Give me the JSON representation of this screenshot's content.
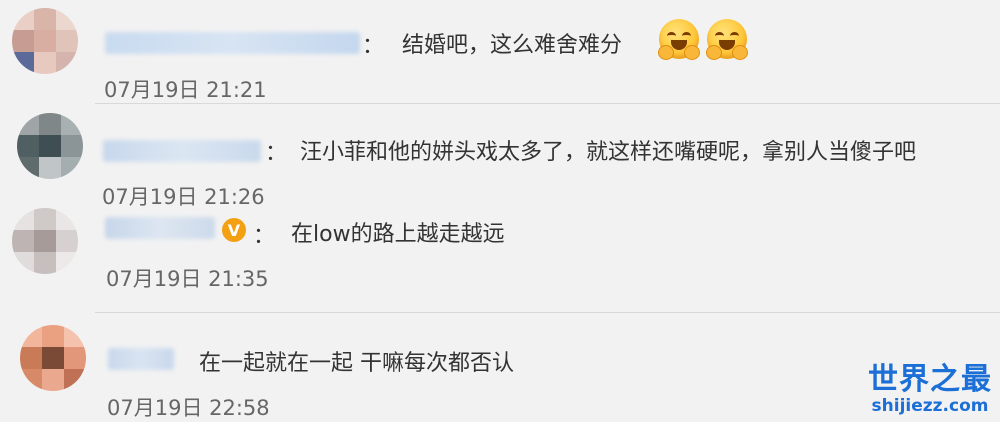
{
  "comments": [
    {
      "text": "结婚吧，这么难舍难分",
      "time": "07月19日 21:21",
      "emojis": [
        "grinning-hands-emoji",
        "grinning-hands-emoji"
      ]
    },
    {
      "text": "汪小菲和他的姘头戏太多了，就这样还嘴硬呢，拿别人当傻子吧",
      "time": "07月19日 21:26"
    },
    {
      "text": "在low的路上越走越远",
      "time": "07月19日 21:35",
      "badge": "V"
    },
    {
      "text": "在一起就在一起 干嘛每次都否认",
      "time": "07月19日 22:58"
    }
  ],
  "punctuation": {
    "colon": "："
  },
  "watermark": {
    "title": "世界之最",
    "domain": "shijiezz.com"
  },
  "colors": {
    "accent": "#1b6fd6",
    "badge": "#f3a012",
    "background": "#f2f2f2"
  }
}
